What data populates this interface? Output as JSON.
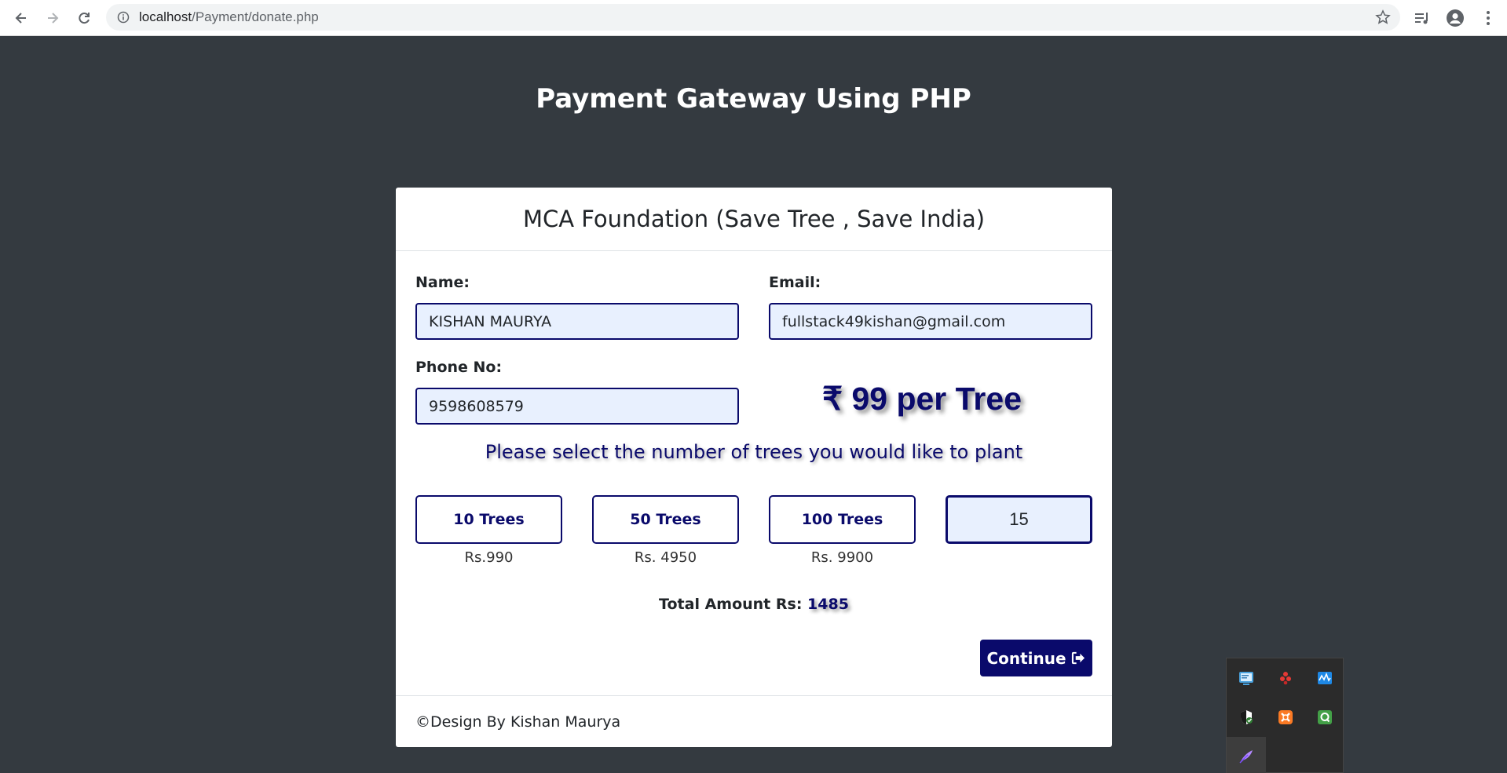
{
  "browser": {
    "url_host": "localhost",
    "url_path": "/Payment/donate.php"
  },
  "page": {
    "title": "Payment Gateway Using PHP"
  },
  "card": {
    "header": "MCA Foundation (Save Tree , Save India)",
    "name_label": "Name:",
    "name_value": "KISHAN MAURYA",
    "email_label": "Email:",
    "email_value": "fullstack49kishan@gmail.com",
    "phone_label": "Phone No:",
    "phone_value": "9598608579",
    "price_tag": "₹ 99 per Tree",
    "select_message": "Please select the number of trees you would like to plant",
    "options": [
      {
        "label": "10 Trees",
        "price": "Rs.990"
      },
      {
        "label": "50 Trees",
        "price": "Rs. 4950"
      },
      {
        "label": "100 Trees",
        "price": "Rs. 9900"
      }
    ],
    "custom_quantity": "15",
    "total_label": "Total Amount Rs:",
    "total_value": "1485",
    "continue_label": "Continue",
    "footer": "©Design By Kishan Maurya"
  },
  "tray_icons": [
    "network-icon",
    "cluster-icon",
    "audio-monitor-icon",
    "security-shield-icon",
    "xampp-icon",
    "q-app-icon",
    "feather-pen-icon"
  ],
  "colors": {
    "page_bg": "#343a40",
    "accent": "#0a0a6b",
    "input_bg": "#e8f0fe"
  }
}
